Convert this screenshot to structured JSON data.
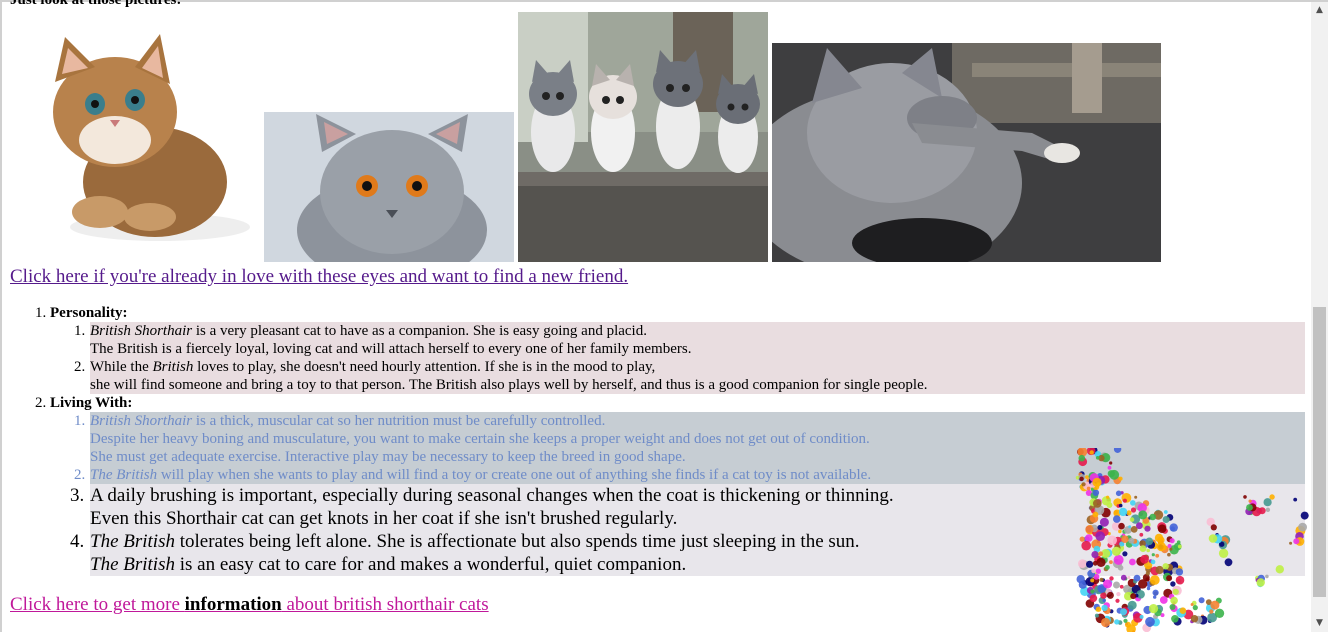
{
  "intro_text": "Just look at those pictures:",
  "images": [
    {
      "name": "fluffy-kitten-image",
      "alt": "Fluffy tabby kitten"
    },
    {
      "name": "grey-cat-face-image",
      "alt": "Grey British Shorthair face"
    },
    {
      "name": "kittens-group-image",
      "alt": "Four kittens on a cat tree"
    },
    {
      "name": "grey-cat-lounging-image",
      "alt": "Grey cat lounging"
    }
  ],
  "love_link": "Click here if you're already in love with these eyes and want to find a new friend.",
  "sections": [
    {
      "label": "Personality:",
      "items": [
        {
          "em": "British Shorthair",
          "line1": " is a very pleasant cat to have as a companion. She is easy going and placid.",
          "line2": "The British is a fiercely loyal, loving cat and will attach herself to every one of her family members."
        },
        {
          "pre": "While the ",
          "em": "British",
          "line1": " loves to play, she doesn't need hourly attention. If she is in the mood to play,",
          "line2": "she will find someone and bring a toy to that person. The British also plays well by herself, and thus is a good companion for single people."
        }
      ]
    },
    {
      "label": "Living With:",
      "items": [
        {
          "em": "British Shorthair",
          "line1": " is a thick, muscular cat so her nutrition must be carefully controlled.",
          "line2": "Despite her heavy boning and musculature, you want to make certain she keeps a proper weight and does not get out of condition.",
          "line3": "She must get adequate exercise. Interactive play may be necessary to keep the breed in good shape."
        },
        {
          "em": "The British",
          "line1": " will play when she wants to play and will find a toy or create one out of anything she finds if a cat toy is not available."
        },
        {
          "line1": "A daily brushing is important, especially during seasonal changes when the coat is thickening or thinning.",
          "line2": "Even this Shorthair cat can get knots in her coat if she isn't brushed regularly."
        },
        {
          "em": "The British",
          "line1": " tolerates being left alone. She is affectionate but also spends time just sleeping in the sun.",
          "em2": "The British",
          "line2": " is an easy cat to care for and makes a wonderful, quiet companion."
        }
      ]
    }
  ],
  "info_link": {
    "before": "Click here to get more ",
    "bold": "information",
    "after": " about british shorthair cats"
  },
  "colors": {
    "visited_link": "#551a8b",
    "info_link": "#c0189a",
    "band_personality": "#e9dde0",
    "band_living_blue": "#c6cdd3",
    "band_living_light": "#e8e6eb",
    "faded_text": "#6f8cc8"
  }
}
